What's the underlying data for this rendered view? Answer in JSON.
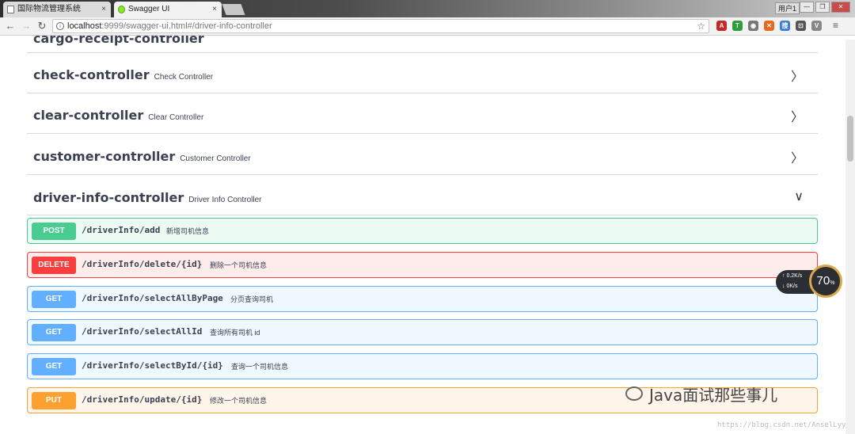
{
  "browser": {
    "tabs": [
      {
        "title": "国际物流管理系统",
        "close": "×"
      },
      {
        "title": "Swagger UI",
        "close": "×"
      }
    ],
    "user_label": "用户1",
    "window_buttons": [
      "—",
      "❐",
      "✕"
    ],
    "nav": {
      "back": "←",
      "forward": "→",
      "reload": "↻"
    },
    "url_host": "localhost",
    "url_path": ":9999/swagger-ui.html#/driver-info-controller",
    "bookmark_star": "☆",
    "extensions": [
      "A",
      "T",
      "◉",
      "✕",
      "搜",
      "⊡",
      "V",
      "≡"
    ]
  },
  "controllers": [
    {
      "name": "cargo-receipt-controller",
      "desc": "",
      "chevron": ""
    },
    {
      "name": "check-controller",
      "desc": "Check Controller",
      "chevron": "〉"
    },
    {
      "name": "clear-controller",
      "desc": "Clear Controller",
      "chevron": "〉"
    },
    {
      "name": "customer-controller",
      "desc": "Customer Controller",
      "chevron": "〉"
    },
    {
      "name": "driver-info-controller",
      "desc": "Driver Info Controller",
      "chevron": "∨"
    }
  ],
  "operations": [
    {
      "method": "POST",
      "path": "/driverInfo/add",
      "summary": "新增司机信息"
    },
    {
      "method": "DELETE",
      "path": "/driverInfo/delete/{id}",
      "summary": "删除一个司机信息"
    },
    {
      "method": "GET",
      "path": "/driverInfo/selectAllByPage",
      "summary": "分页查询司机"
    },
    {
      "method": "GET",
      "path": "/driverInfo/selectAllId",
      "summary": "查询所有司机 id"
    },
    {
      "method": "GET",
      "path": "/driverInfo/selectById/{id}",
      "summary": "查询一个司机信息"
    },
    {
      "method": "PUT",
      "path": "/driverInfo/update/{id}",
      "summary": "修改一个司机信息"
    }
  ],
  "speed_widget": {
    "up": "↑ 0.2K/s",
    "down": "↓ 0K/s",
    "percent": "70",
    "percent_unit": "%"
  },
  "watermark": {
    "text": "Java面试那些事儿",
    "url": "https://blog.csdn.net/AnselLyy"
  }
}
